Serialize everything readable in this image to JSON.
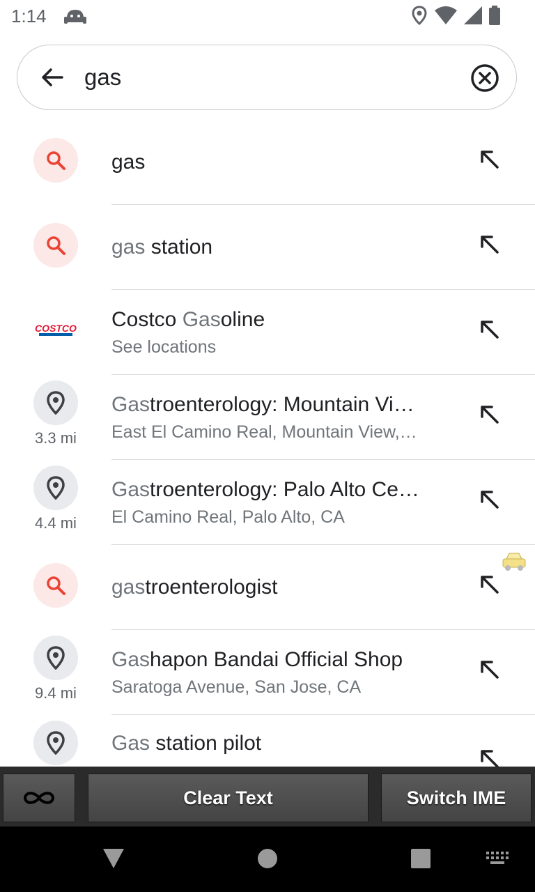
{
  "status_bar": {
    "time": "1:14",
    "icons": [
      "android-robot-icon",
      "location-icon",
      "wifi-icon",
      "signal-icon",
      "battery-icon"
    ]
  },
  "search": {
    "query": "gas"
  },
  "results": [
    {
      "type": "search",
      "title_highlight": "",
      "title_rest": "gas",
      "subtitle": "",
      "distance": ""
    },
    {
      "type": "search",
      "title_highlight": "gas",
      "title_rest": " station",
      "subtitle": "",
      "distance": ""
    },
    {
      "type": "brand",
      "title_plain": "Costco ",
      "title_highlight": "Gas",
      "title_rest": "oline",
      "subtitle": "See locations",
      "distance": ""
    },
    {
      "type": "place",
      "title_highlight": "Gas",
      "title_rest": "troenterology: Mountain Vi…",
      "subtitle": "East El Camino Real, Mountain View,…",
      "distance": "3.3 mi"
    },
    {
      "type": "place",
      "title_highlight": "Gas",
      "title_rest": "troenterology: Palo Alto Ce…",
      "subtitle": "El Camino Real, Palo Alto, CA",
      "distance": "4.4 mi"
    },
    {
      "type": "search",
      "title_highlight": "gas",
      "title_rest": "troenterologist",
      "subtitle": "",
      "distance": ""
    },
    {
      "type": "place",
      "title_highlight": "Gas",
      "title_rest": "hapon Bandai Official Shop",
      "subtitle": "Saratoga Avenue, San Jose, CA",
      "distance": "9.4 mi"
    },
    {
      "type": "place",
      "title_highlight": "Gas",
      "title_rest": " station pilot",
      "subtitle": "",
      "distance": ""
    }
  ],
  "ime_bar": {
    "clear_label": "Clear Text",
    "switch_label": "Switch IME"
  },
  "colors": {
    "accent_red": "#ea4335",
    "search_bg": "#fce8e6",
    "place_bg": "#e8eaed"
  }
}
